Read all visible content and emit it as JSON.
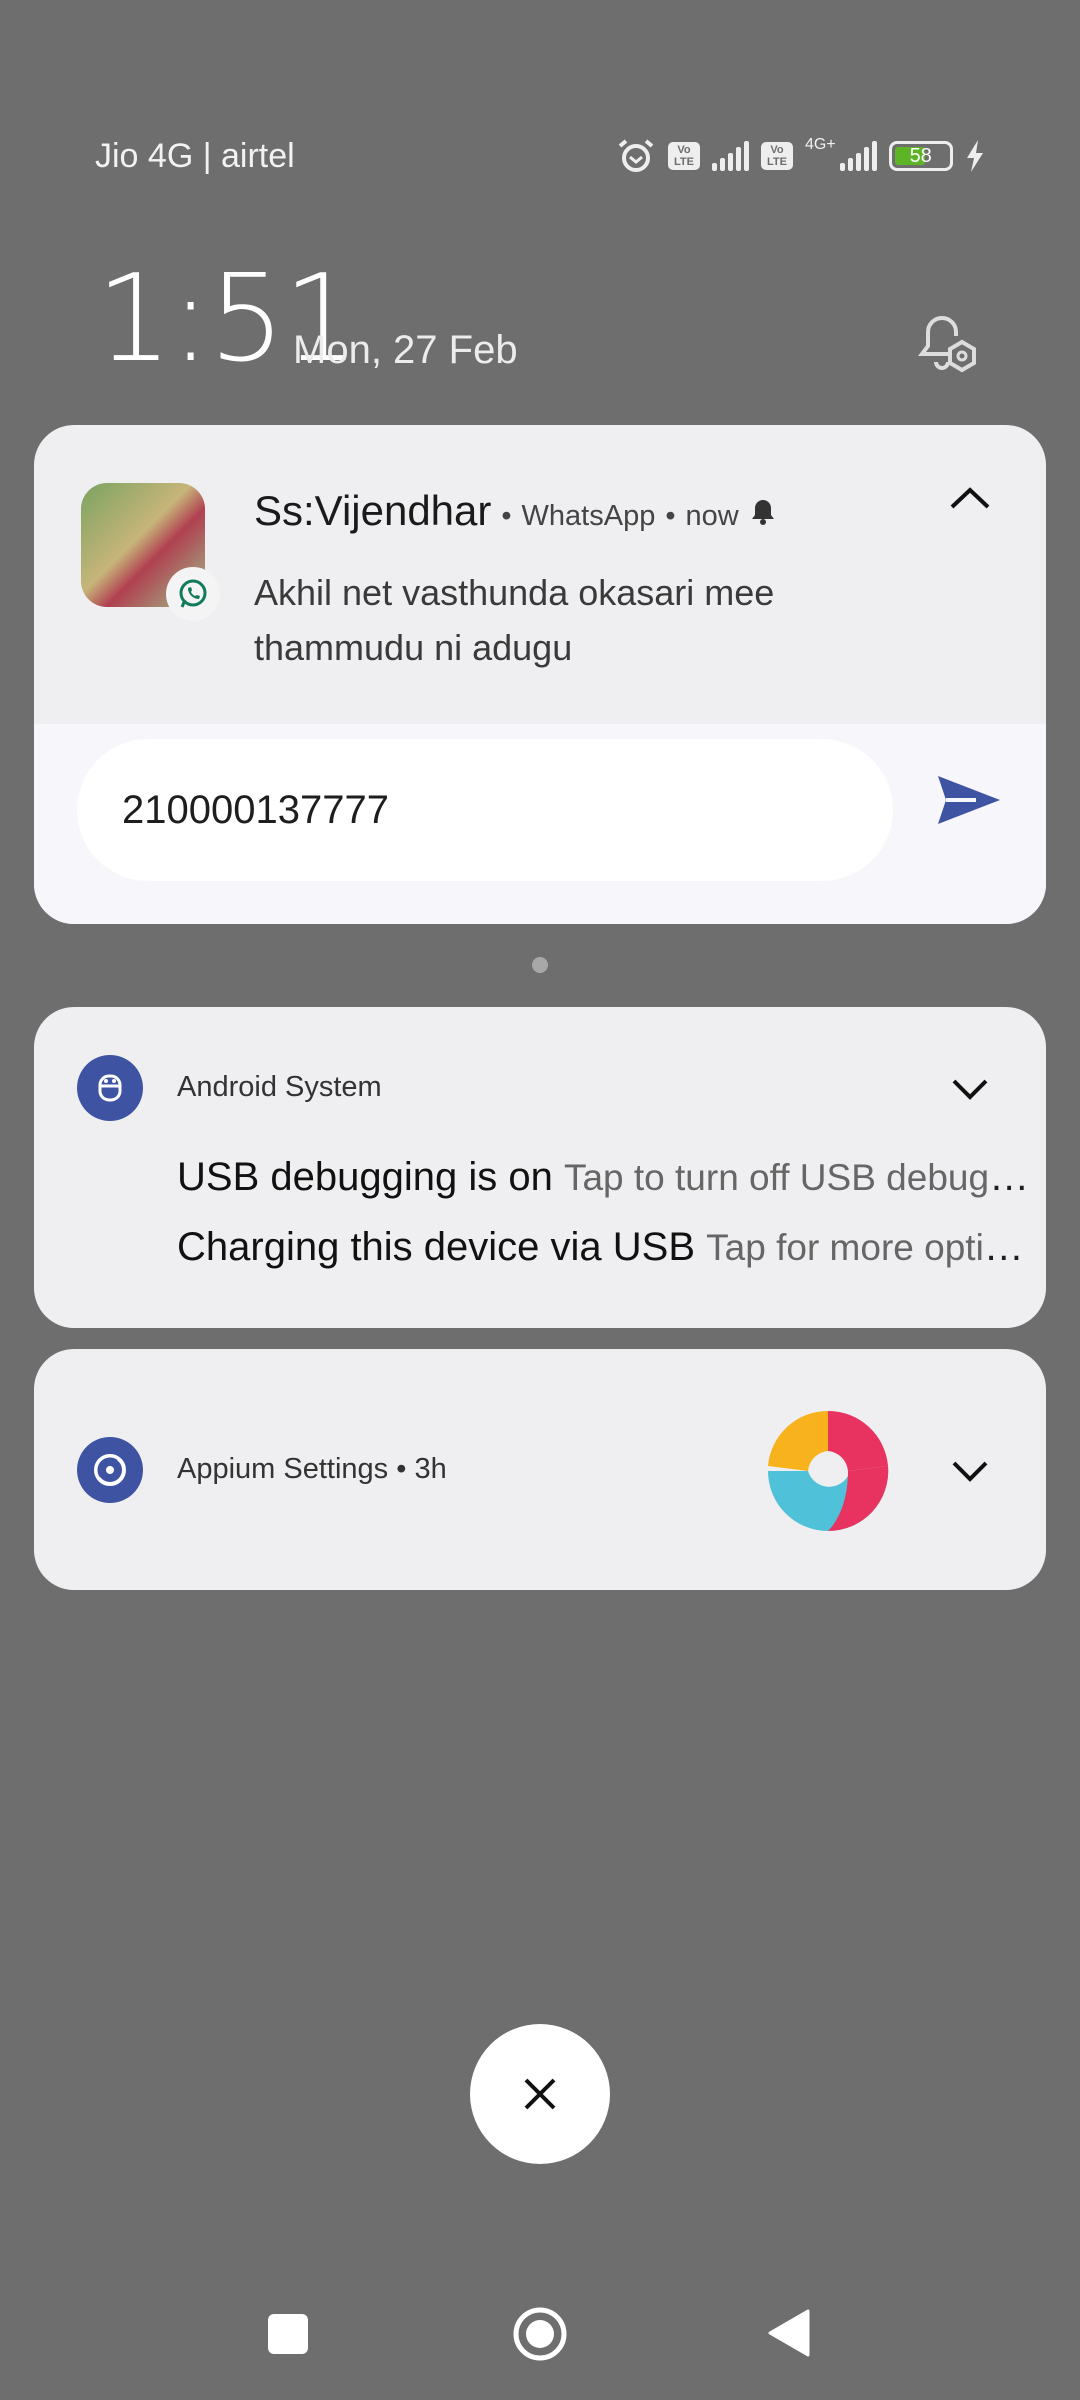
{
  "status_bar": {
    "carrier": "Jio 4G | airtel",
    "network": "4G+",
    "battery": "58",
    "battery_percent": 58,
    "battery_color": "#5db526"
  },
  "lock": {
    "time": "1:51",
    "date": "Mon, 27 Feb"
  },
  "whatsapp": {
    "sender": "Ss:Vijendhar",
    "app": "WhatsApp",
    "time": "now",
    "message": "Akhil net vasthunda okasari mee thammudu ni adugu",
    "reply_value": "210000137777",
    "accent": "#3e54a3"
  },
  "android_system": {
    "app": "Android System",
    "items": [
      {
        "title": "USB debugging is on",
        "text": "Tap to turn off USB debugging"
      },
      {
        "title": "Charging this device via USB",
        "text": "Tap for more options."
      }
    ]
  },
  "appium": {
    "app": "Appium Settings",
    "time": "3h"
  }
}
